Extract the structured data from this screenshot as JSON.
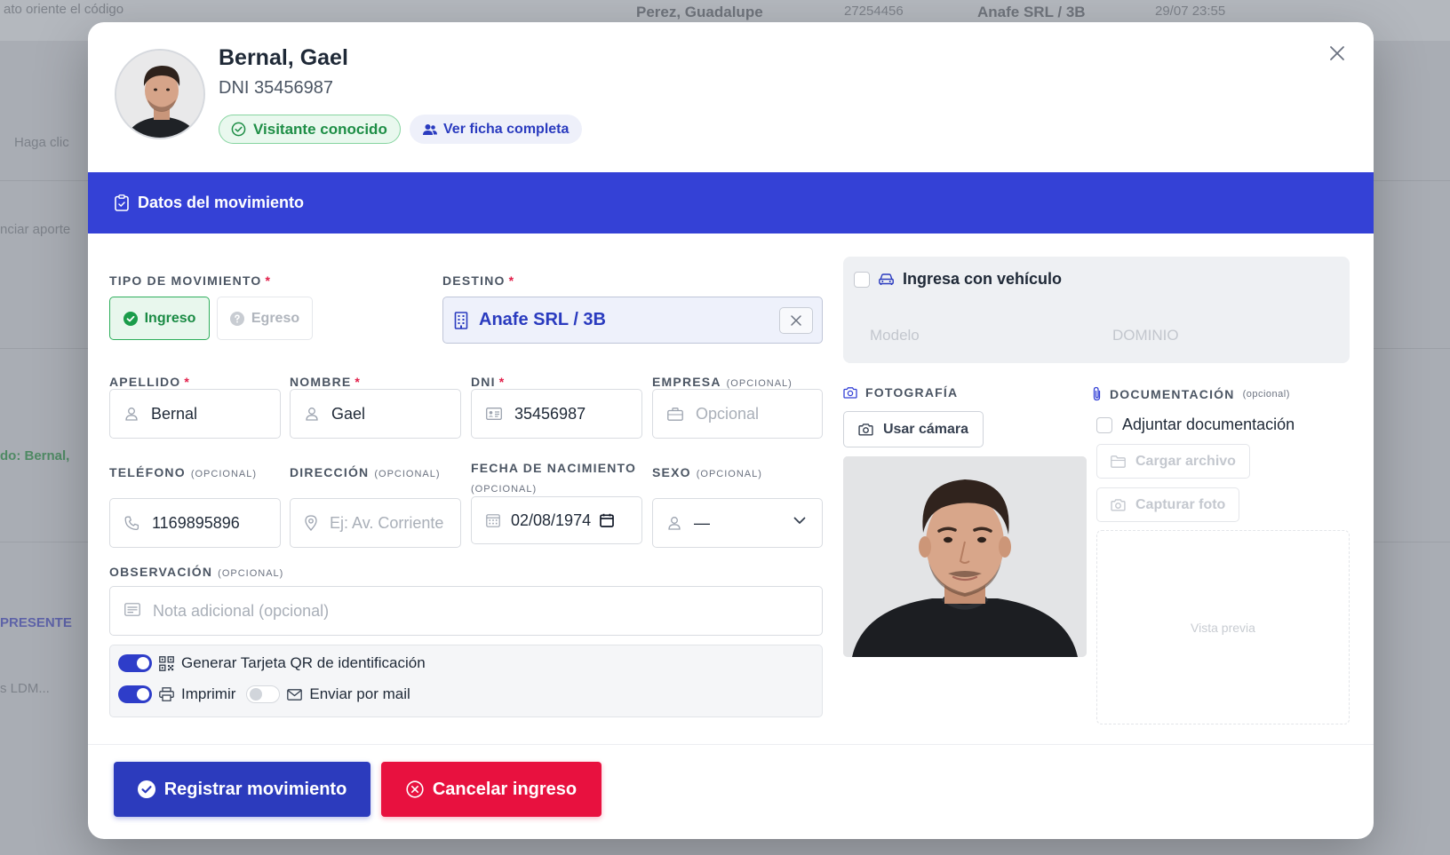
{
  "background": {
    "top_text": "ato oriente el código",
    "row1": [
      "Perez, Guadalupe",
      "27254456",
      "Anafe SRL / 3B",
      "29/07 23:55"
    ],
    "side_texts": [
      "Haga clic",
      "nciar aporte",
      "do: Bernal,",
      "PRESENTE",
      "s LDM..."
    ]
  },
  "visitor": {
    "name": "Bernal, Gael",
    "dni_line": "DNI 35456987",
    "known_badge": "Visitante conocido",
    "ficha_button": "Ver ficha completa"
  },
  "section": {
    "title": "Datos del movimiento"
  },
  "form": {
    "tipo": {
      "label": "TIPO DE MOVIMIENTO",
      "required": "*",
      "ingreso": "Ingreso",
      "egreso": "Egreso"
    },
    "destino": {
      "label": "DESTINO",
      "required": "*",
      "value": "Anafe SRL / 3B"
    },
    "apellido": {
      "label": "APELLIDO",
      "required": "*",
      "value": "Bernal"
    },
    "nombre": {
      "label": "NOMBRE",
      "required": "*",
      "value": "Gael"
    },
    "dni": {
      "label": "DNI",
      "required": "*",
      "value": "35456987"
    },
    "empresa": {
      "label": "EMPRESA",
      "optional": "(OPCIONAL)",
      "placeholder": "Opcional"
    },
    "telefono": {
      "label": "TELÉFONO",
      "optional": "(OPCIONAL)",
      "value": "1169895896"
    },
    "direccion": {
      "label": "DIRECCIÓN",
      "optional": "(OPCIONAL)",
      "placeholder": "Ej: Av. Corriente"
    },
    "fecha": {
      "label": "FECHA DE NACIMIENTO",
      "optional": "(OPCIONAL)",
      "value": "02/08/1974"
    },
    "sexo": {
      "label": "SEXO",
      "optional": "(OPCIONAL)",
      "value": "—"
    },
    "observacion": {
      "label": "OBSERVACIÓN",
      "optional": "(OPCIONAL)",
      "placeholder": "Nota adicional (opcional)"
    },
    "options": {
      "qr_label": "Generar Tarjeta QR de identificación",
      "imprimir_label": "Imprimir",
      "mail_label": "Enviar por mail"
    }
  },
  "vehicle": {
    "label": "Ingresa con vehículo",
    "modelo_placeholder": "Modelo",
    "dominio_placeholder": "DOMINIO"
  },
  "photo": {
    "label": "FOTOGRAFÍA",
    "camera_button": "Usar cámara"
  },
  "documents": {
    "label": "DOCUMENTACIÓN",
    "optional": "(opcional)",
    "attach_label": "Adjuntar documentación",
    "upload_button": "Cargar archivo",
    "capture_button": "Capturar foto",
    "preview": "Vista previa"
  },
  "actions": {
    "register": "Registrar movimiento",
    "cancel": "Cancelar ingreso"
  },
  "colors": {
    "primary": "#2c3bbd",
    "band": "#3441d6",
    "success": "#1a8b44",
    "danger": "#e8113f"
  }
}
